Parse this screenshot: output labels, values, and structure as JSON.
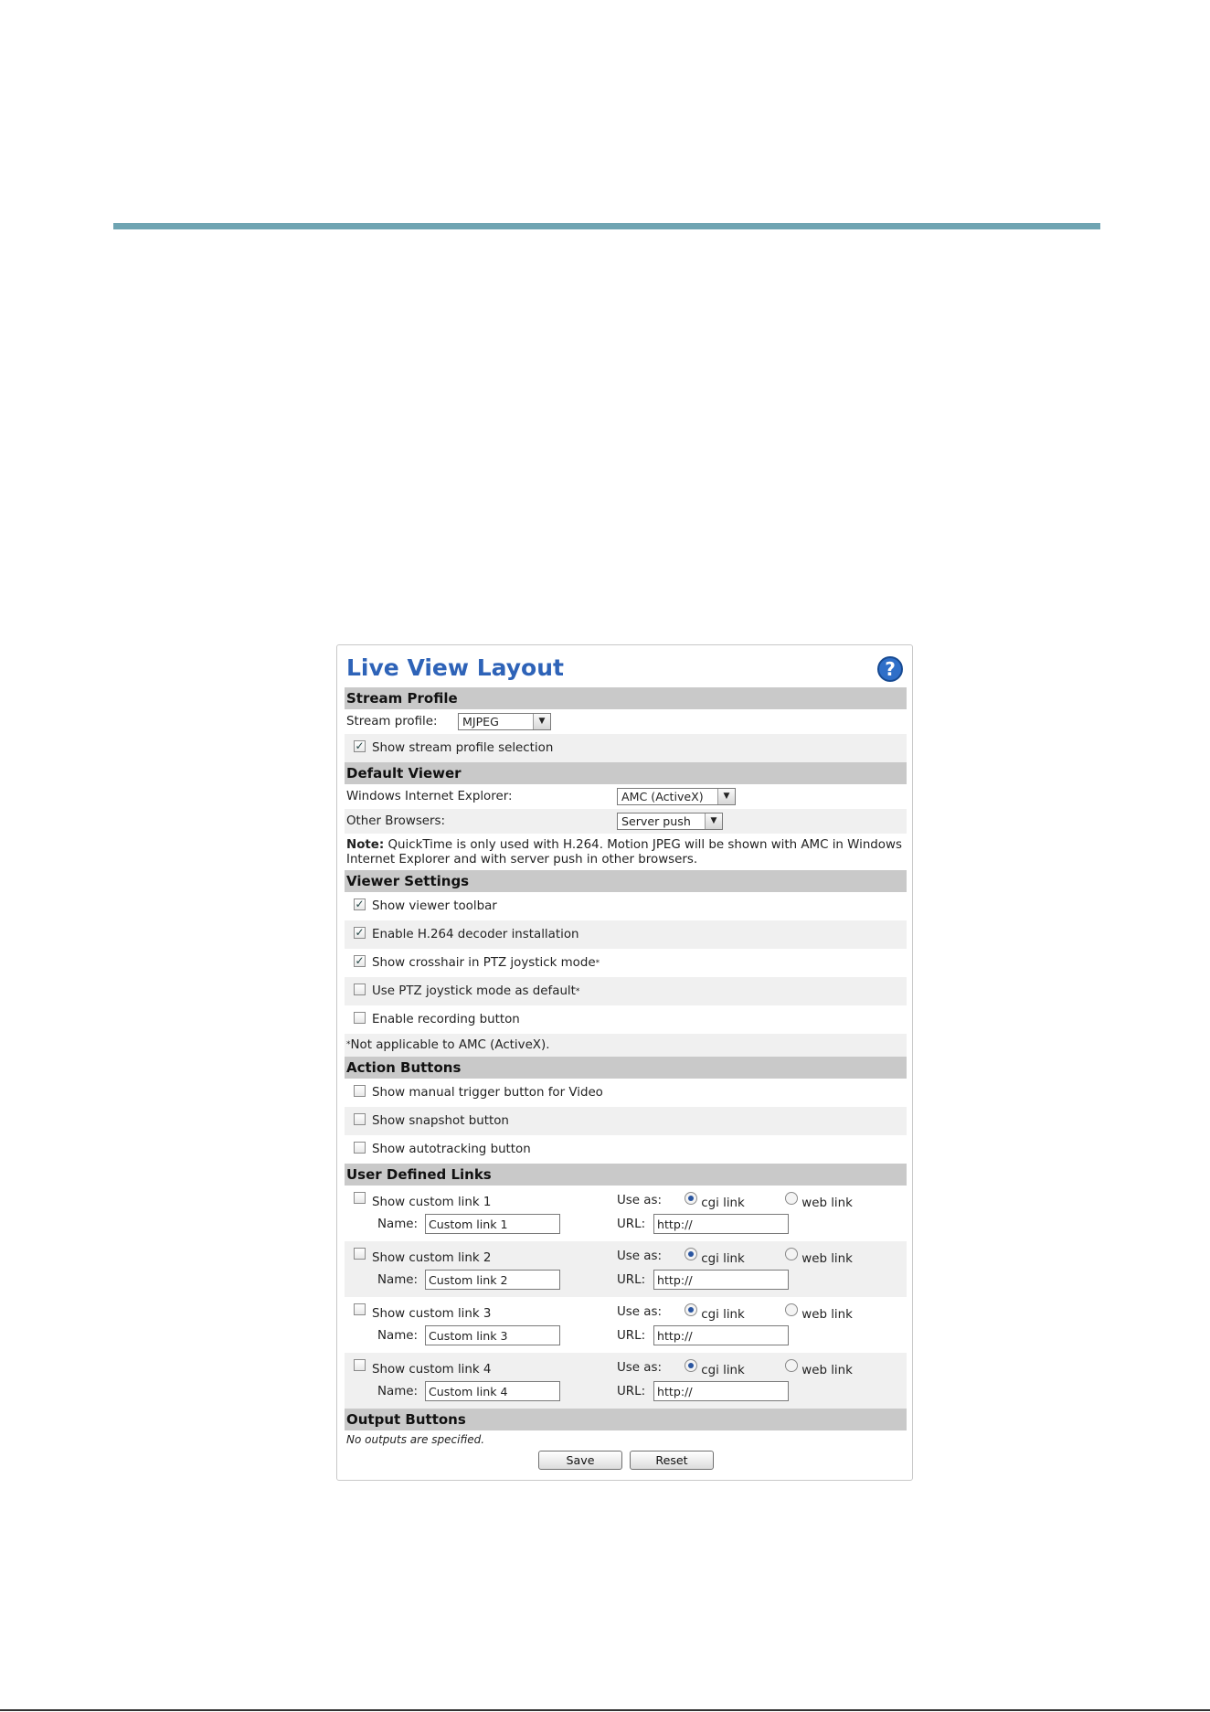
{
  "page": {
    "title": "Live View Layout"
  },
  "stream_profile": {
    "header": "Stream Profile",
    "label": "Stream profile:",
    "value": "MJPEG",
    "show_selection_label": "Show stream profile selection",
    "show_selection_checked": true
  },
  "default_viewer": {
    "header": "Default Viewer",
    "ie_label": "Windows Internet Explorer:",
    "ie_value": "AMC (ActiveX)",
    "other_label": "Other Browsers:",
    "other_value": "Server push",
    "note_bold": "Note:",
    "note_text": " QuickTime is only used with H.264. Motion JPEG will be shown with AMC in Windows Internet Explorer and with server push in other browsers."
  },
  "viewer_settings": {
    "header": "Viewer Settings",
    "items": [
      {
        "label": "Show viewer toolbar",
        "checked": true,
        "sup": ""
      },
      {
        "label": "Enable H.264 decoder installation",
        "checked": true,
        "sup": ""
      },
      {
        "label": "Show crosshair in PTZ joystick mode",
        "checked": true,
        "sup": "*"
      },
      {
        "label": "Use PTZ joystick mode as default",
        "checked": false,
        "sup": "*"
      },
      {
        "label": "Enable recording button",
        "checked": false,
        "sup": ""
      }
    ],
    "footnote_mark": "*",
    "footnote": "Not applicable to AMC (ActiveX)."
  },
  "action_buttons": {
    "header": "Action Buttons",
    "items": [
      {
        "label": "Show manual trigger button for Video",
        "checked": false
      },
      {
        "label": "Show snapshot button",
        "checked": false
      },
      {
        "label": "Show autotracking button",
        "checked": false
      }
    ]
  },
  "user_links": {
    "header": "User Defined Links",
    "use_as_label": "Use as:",
    "cgi_label": "cgi link",
    "web_label": "web link",
    "name_label": "Name:",
    "url_label": "URL:",
    "links": [
      {
        "label": "Show custom link 1",
        "name": "Custom link 1",
        "url": "http://",
        "use_as": "cgi"
      },
      {
        "label": "Show custom link 2",
        "name": "Custom link 2",
        "url": "http://",
        "use_as": "cgi"
      },
      {
        "label": "Show custom link 3",
        "name": "Custom link 3",
        "url": "http://",
        "use_as": "cgi"
      },
      {
        "label": "Show custom link 4",
        "name": "Custom link 4",
        "url": "http://",
        "use_as": "cgi"
      }
    ]
  },
  "output_buttons": {
    "header": "Output Buttons",
    "note": "No outputs are specified."
  },
  "buttons": {
    "save": "Save",
    "reset": "Reset"
  },
  "colors": {
    "title": "#2e63b8",
    "rule": "#6fa4b2",
    "header_bg": "#c9c9c9"
  },
  "icons": {
    "help": "help-question-icon",
    "check": "checkmark-icon"
  }
}
